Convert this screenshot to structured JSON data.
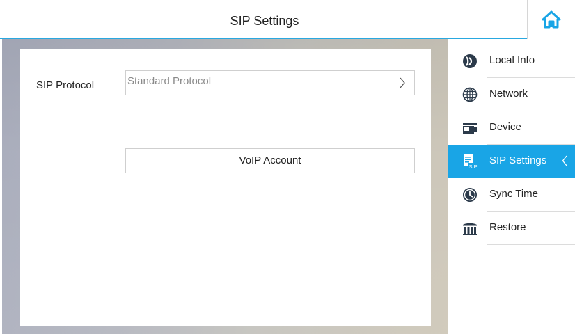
{
  "header": {
    "title": "SIP Settings",
    "home_icon": "home-icon"
  },
  "form": {
    "sip_protocol_label": "SIP Protocol",
    "sip_protocol_value": "Standard Protocol",
    "voip_account_label": "VoIP Account"
  },
  "sidebar": {
    "items": [
      {
        "label": "Local Info",
        "icon": "local-info-icon",
        "active": false
      },
      {
        "label": "Network",
        "icon": "globe-icon",
        "active": false
      },
      {
        "label": "Device",
        "icon": "device-icon",
        "active": false
      },
      {
        "label": "SIP Settings",
        "icon": "sip-icon",
        "active": true
      },
      {
        "label": "Sync Time",
        "icon": "clock-icon",
        "active": false
      },
      {
        "label": "Restore",
        "icon": "restore-icon",
        "active": false
      }
    ]
  },
  "colors": {
    "accent": "#19a5e6",
    "header_underline": "#29a8e0",
    "icon_dark": "#2b3a4a"
  }
}
